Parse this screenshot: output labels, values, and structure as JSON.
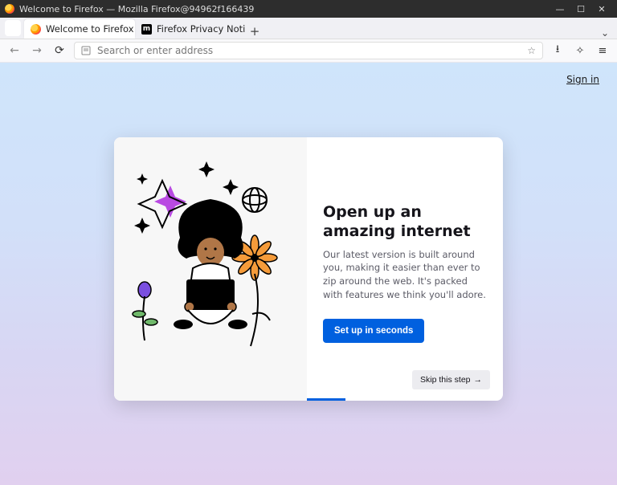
{
  "window": {
    "title": "Welcome to Firefox — Mozilla Firefox@94962f166439",
    "controls": {
      "min": "—",
      "max": "☐",
      "close": "✕"
    }
  },
  "tabs": [
    {
      "label": "Welcome to Firefox",
      "active": true,
      "icon": "firefox"
    },
    {
      "label": "Firefox Privacy Notice — …",
      "active": false,
      "icon": "moz"
    }
  ],
  "toolbar": {
    "back": "←",
    "forward": "→",
    "reload": "⟳",
    "urlbar_placeholder": "Search or enter address",
    "bookmark": "☆",
    "save": "⭳",
    "extensions": "✧",
    "menu": "≡"
  },
  "content": {
    "sign_in": "Sign in",
    "headline": "Open up an amazing internet",
    "description": "Our latest version is built around you, making it easier than ever to zip around the web. It's packed with features we think you'll adore.",
    "primary_button": "Set up in seconds",
    "skip_button": "Skip this step"
  }
}
